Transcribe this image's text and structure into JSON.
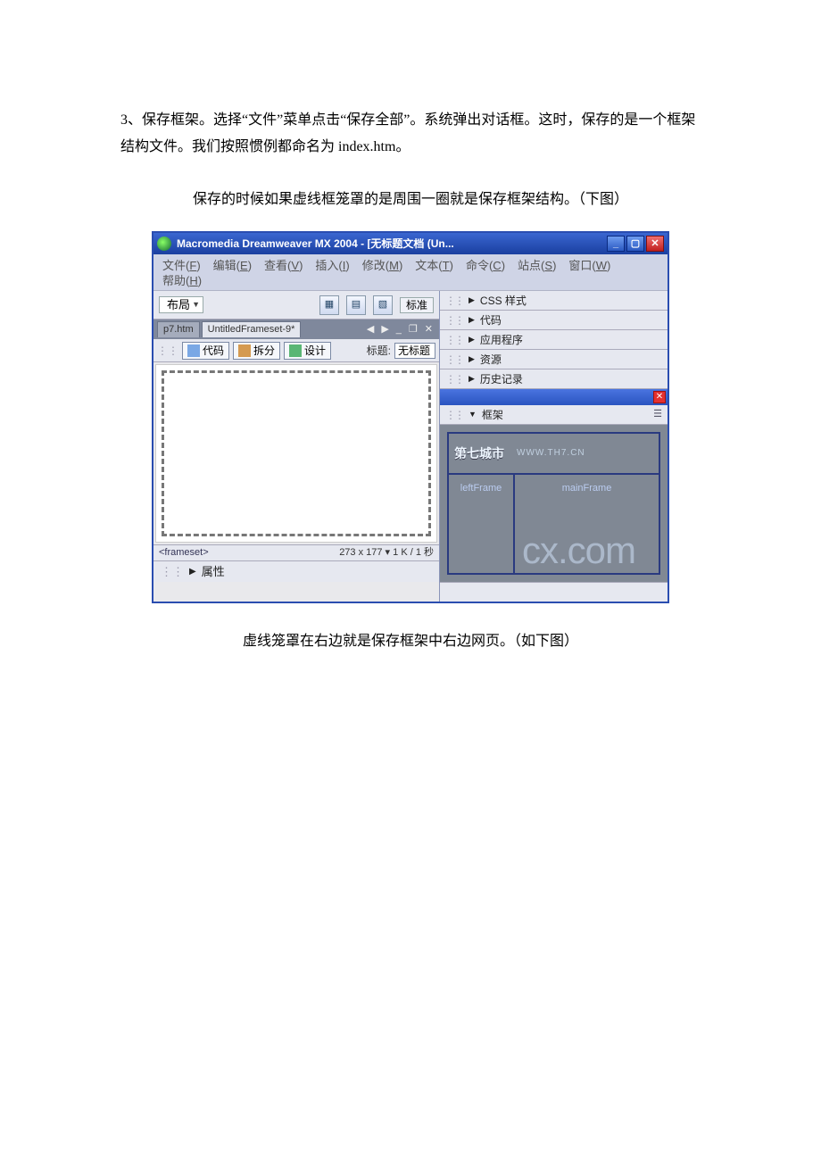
{
  "doc": {
    "para1": "3、保存框架。选择“文件”菜单点击“保存全部”。系统弹出对话框。这时，保存的是一个框架结构文件。我们按照惯例都命名为 index.htm。",
    "caption1": "保存的时候如果虚线框笼罩的是周围一圈就是保存框架结构。（下图）",
    "caption2": "虚线笼罩在右边就是保存框架中右边网页。（如下图）"
  },
  "shot": {
    "title": "Macromedia Dreamweaver MX 2004 - [无标题文档 (Un...",
    "menus": [
      {
        "label": "文件",
        "hk": "F"
      },
      {
        "label": "编辑",
        "hk": "E"
      },
      {
        "label": "查看",
        "hk": "V"
      },
      {
        "label": "插入",
        "hk": "I"
      },
      {
        "label": "修改",
        "hk": "M"
      },
      {
        "label": "文本",
        "hk": "T"
      },
      {
        "label": "命令",
        "hk": "C"
      },
      {
        "label": "站点",
        "hk": "S"
      },
      {
        "label": "窗口",
        "hk": "W"
      },
      {
        "label": "帮助",
        "hk": "H"
      }
    ],
    "insertbar": {
      "layout": "布局",
      "std": "标准"
    },
    "doctabs": {
      "tab1": "p7.htm",
      "tab2": "UntitledFrameset-9*"
    },
    "view": {
      "code": "代码",
      "split": "拆分",
      "design": "设计",
      "titlelbl": "标题:",
      "titleval": "无标题"
    },
    "status": {
      "tag": "<frameset>",
      "size": "273 x 177 ▾ 1 K / 1 秒"
    },
    "properties": "属性",
    "panels": {
      "css": "CSS 样式",
      "code": "代码",
      "app": "应用程序",
      "res": "资源",
      "history": "历史记录",
      "frames": "框架"
    },
    "frames": {
      "wm_main": "第七城市",
      "wm_sub": "WWW.TH7.CN",
      "left": "leftFrame",
      "main": "mainFrame",
      "bigwm": "cx.com"
    }
  }
}
